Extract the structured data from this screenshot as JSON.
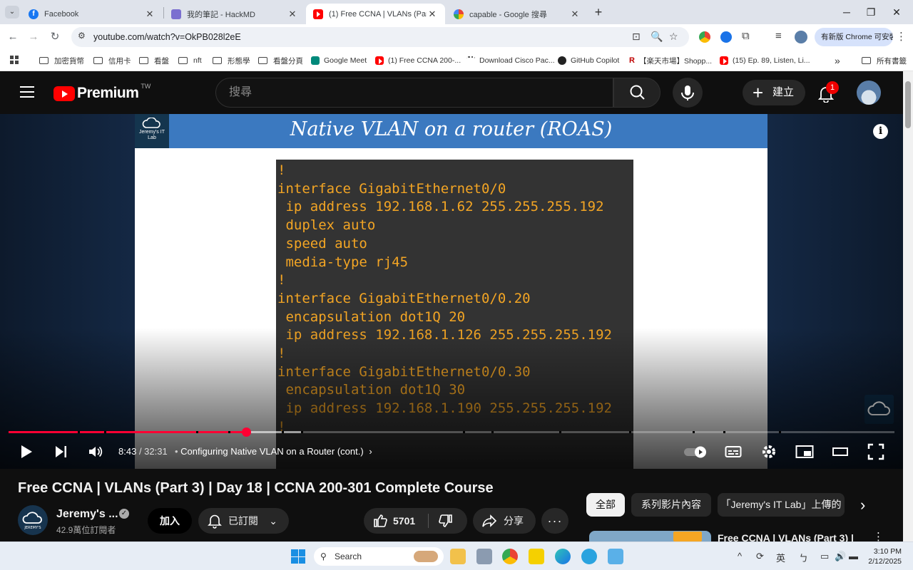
{
  "browser": {
    "tabs": [
      {
        "title": "Facebook",
        "favicon": "facebook-icon",
        "active": false
      },
      {
        "title": "我的筆記 - HackMD",
        "favicon": "hackmd-icon",
        "active": false
      },
      {
        "title": "(1) Free CCNA | VLANs (Part 3) |",
        "favicon": "youtube-icon",
        "active": true
      },
      {
        "title": "capable - Google 搜尋",
        "favicon": "google-icon",
        "active": false
      }
    ],
    "url": "youtube.com/watch?v=OkPB028l2eE",
    "update_label": "有新版 Chrome 可安裝",
    "bookmarks": [
      {
        "label": "加密貨幣",
        "type": "folder"
      },
      {
        "label": "信用卡",
        "type": "folder"
      },
      {
        "label": "看盤",
        "type": "folder"
      },
      {
        "label": "nft",
        "type": "folder"
      },
      {
        "label": "形態學",
        "type": "folder"
      },
      {
        "label": "看盤分頁",
        "type": "folder"
      },
      {
        "label": "Google Meet",
        "type": "link"
      },
      {
        "label": "(1) Free CCNA 200-...",
        "type": "link"
      },
      {
        "label": "Download Cisco Pac...",
        "type": "link"
      },
      {
        "label": "GitHub Copilot",
        "type": "link"
      },
      {
        "label": "【楽天市場】Shopp...",
        "type": "link"
      },
      {
        "label": "(15) Ep. 89, Listen, Li...",
        "type": "link"
      }
    ],
    "bookmarks_more": "»",
    "all_bookmarks": "所有書籤"
  },
  "youtube": {
    "logo_text": "Premium",
    "country_code": "TW",
    "search_placeholder": "搜尋",
    "create_label": "建立",
    "notification_count": "1"
  },
  "video": {
    "slide_title": "Native VLAN on a router (ROAS)",
    "slide_logo": "Jeremy's IT Lab",
    "code_lines": [
      "!",
      "interface GigabitEthernet0/0",
      " ip address 192.168.1.62 255.255.255.192",
      " duplex auto",
      " speed auto",
      " media-type rj45",
      "!",
      "interface GigabitEthernet0/0.20",
      " encapsulation dot1Q 20",
      " ip address 192.168.1.126 255.255.255.192",
      "!",
      "interface GigabitEthernet0/0.30",
      " encapsulation dot1Q 30",
      " ip address 192.168.1.190 255.255.255.192",
      "!"
    ],
    "current_time": "8:43",
    "duration": "32:31",
    "progress_fraction": 0.268,
    "buffered_fraction": 0.33,
    "chapter": "Configuring Native VLAN on a Router (cont.)",
    "accent_color": "#ff0033"
  },
  "details": {
    "title": "Free CCNA | VLANs (Part 3) | Day 18 | CCNA 200-301 Complete Course",
    "channel_name": "Jeremy's ...",
    "subscribers": "42.9萬位訂閱者",
    "join_label": "加入",
    "subscribed_label": "已訂閱",
    "like_count": "5701",
    "share_label": "分享",
    "chips": [
      "全部",
      "系列影片內容",
      "「Jeremy's IT Lab」上傳的"
    ],
    "rec_title": "Free CCNA | VLANs (Part 3) |"
  },
  "taskbar": {
    "search_label": "Search",
    "ime": "英",
    "time": "3:10 PM",
    "date": "2/12/2025"
  }
}
